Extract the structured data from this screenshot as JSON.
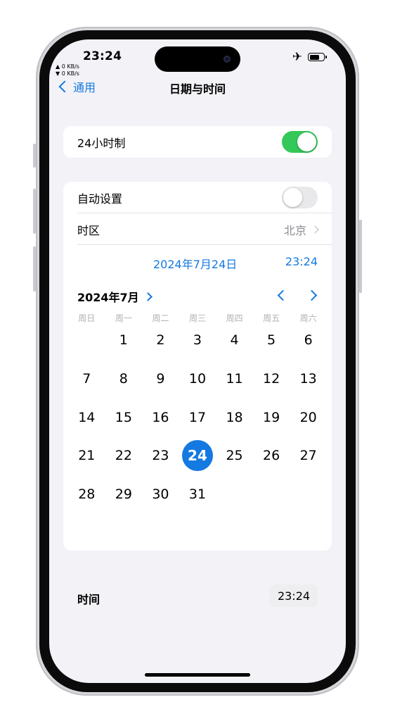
{
  "status_bar": {
    "time": "23:24",
    "upload_speed": "▲ 0 KB/s",
    "download_speed": "▼ 0 KB/s",
    "airplane_icon": "airplane-icon",
    "battery_icon": "battery-icon"
  },
  "nav": {
    "back_label": "通用",
    "title": "日期与时间"
  },
  "settings": {
    "hour24_label": "24小时制",
    "hour24_on": true,
    "auto_label": "自动设置",
    "auto_on": false,
    "timezone_label": "时区",
    "timezone_value": "北京"
  },
  "datetime": {
    "selected_date": "2024年7月24日",
    "selected_time": "23:24"
  },
  "calendar": {
    "month_label": "2024年7月",
    "weekdays": [
      "周日",
      "周一",
      "周二",
      "周三",
      "周四",
      "周五",
      "周六"
    ],
    "days": [
      "",
      "1",
      "2",
      "3",
      "4",
      "5",
      "6",
      "7",
      "8",
      "9",
      "10",
      "11",
      "12",
      "13",
      "14",
      "15",
      "16",
      "17",
      "18",
      "19",
      "20",
      "21",
      "22",
      "23",
      "24",
      "25",
      "26",
      "27",
      "28",
      "29",
      "30",
      "31"
    ],
    "selected_day": "24"
  },
  "time_row": {
    "label": "时间",
    "value": "23:24"
  },
  "colors": {
    "accent": "#1479e0",
    "switch_on": "#34c759",
    "background": "#f2f2f7"
  }
}
